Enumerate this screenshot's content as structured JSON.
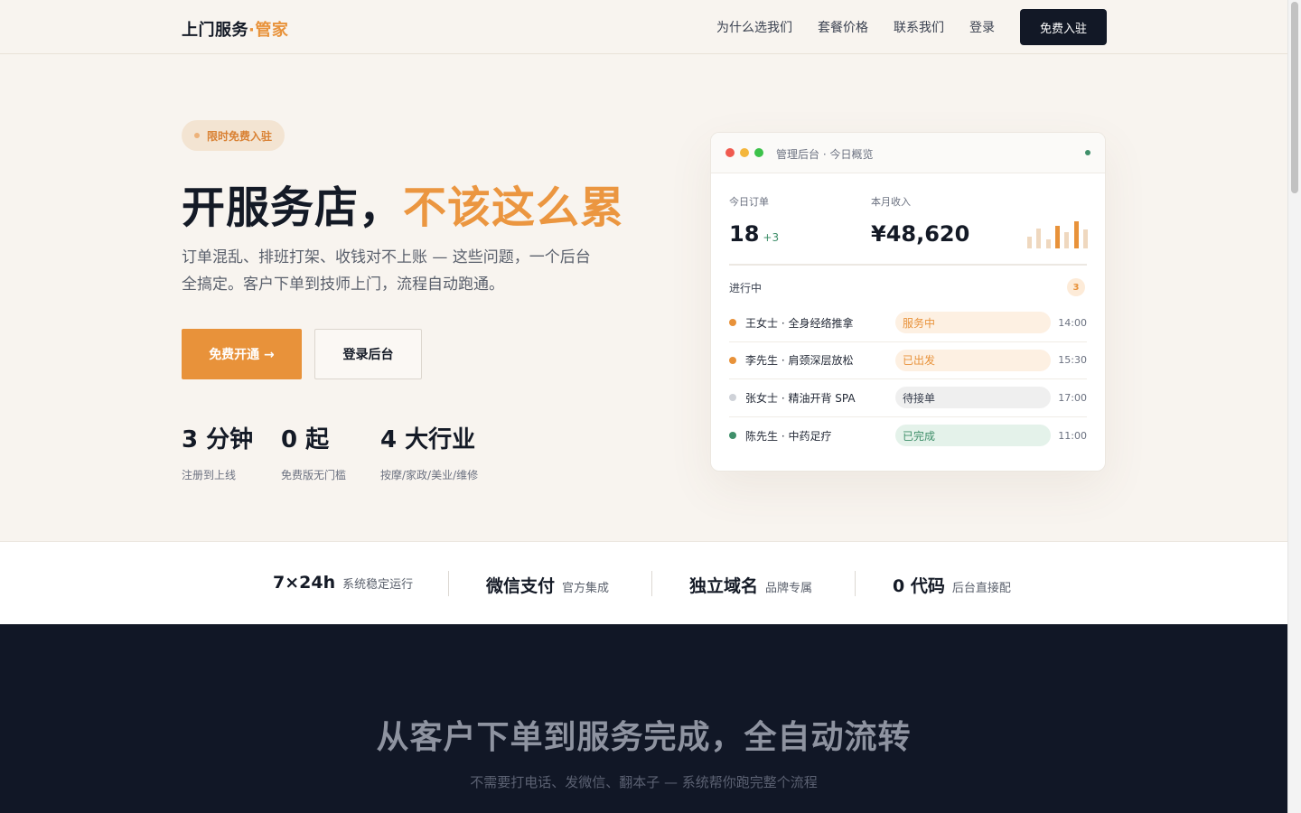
{
  "nav": {
    "brand": "上门服务",
    "brand_accent": "·管家",
    "links": [
      "为什么选我们",
      "套餐价格",
      "联系我们",
      "登录"
    ],
    "cta": "免费入驻"
  },
  "hero": {
    "badge": "限时免费入驻",
    "title": "开服务店，",
    "title_accent": "不该这么累",
    "desc_line1": "订单混乱、排班打架、收钱对不上账 — 这些问题，一个后台",
    "desc_line2": "全搞定。客户下单到技师上门，流程自动跑通。",
    "primary_button": "免费开通 →",
    "secondary_button": "登录后台",
    "stats": [
      {
        "value": "3 分钟",
        "label": "注册到上线"
      },
      {
        "value": "0 起",
        "label": "免费版无门槛"
      },
      {
        "value": "4 大行业",
        "label": "按摩/家政/美业/维修"
      }
    ]
  },
  "dashboard": {
    "title": "管理后台 · 今日概览",
    "orders_label": "今日订单",
    "orders_value": "18",
    "orders_delta": "+3",
    "revenue_label": "本月收入",
    "revenue_value": "¥48,620",
    "revenue_bars": [
      0.45,
      0.75,
      0.35,
      0.85,
      0.6,
      1.0,
      0.7
    ],
    "in_progress_label": "进行中",
    "in_progress_count": "3",
    "rows": [
      {
        "name": "王女士 · 全身经络推拿",
        "status": "服务中",
        "time": "14:00",
        "tone": "orange"
      },
      {
        "name": "李先生 · 肩颈深层放松",
        "status": "已出发",
        "time": "15:30",
        "tone": "orange"
      },
      {
        "name": "张女士 · 精油开背 SPA",
        "status": "待接单",
        "time": "17:00",
        "tone": "gray"
      },
      {
        "name": "陈先生 · 中药足疗",
        "status": "已完成",
        "time": "11:00",
        "tone": "green"
      }
    ]
  },
  "features": [
    {
      "value": "7×24h",
      "label": "系统稳定运行"
    },
    {
      "value": "微信支付",
      "label": "官方集成"
    },
    {
      "value": "独立域名",
      "label": "品牌专属"
    },
    {
      "value": "0 代码",
      "label": "后台直接配"
    }
  ],
  "flow": {
    "title": "从客户下单到服务完成，全自动流转",
    "subtitle": "不需要打电话、发微信、翻本子 — 系统帮你跑完整个流程"
  },
  "colors": {
    "accent": "#e8923a",
    "dark": "#111726",
    "success": "#3f8f6a"
  }
}
